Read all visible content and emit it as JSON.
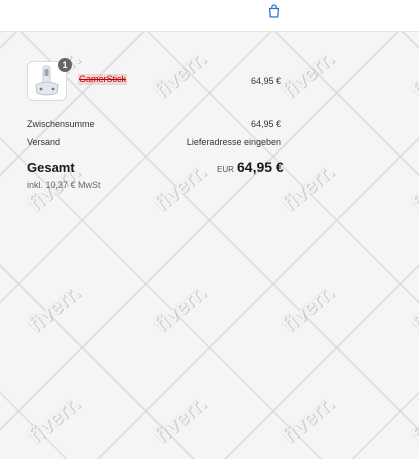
{
  "header": {
    "cart_icon": "shopping-bag-icon"
  },
  "watermark": {
    "text": "fiverr."
  },
  "line_item": {
    "name": "GamerStick",
    "quantity": "1",
    "price": "64,95 €",
    "image": "product-thumbnail"
  },
  "summary": {
    "subtotal_label": "Zwischensumme",
    "subtotal_value": "64,95 €",
    "shipping_label": "Versand",
    "shipping_value": "Lieferadresse eingeben",
    "total_label": "Gesamt",
    "total_currency": "EUR",
    "total_value": "64,95 €",
    "tax_note": "inkl. 10,37 € MwSt"
  }
}
